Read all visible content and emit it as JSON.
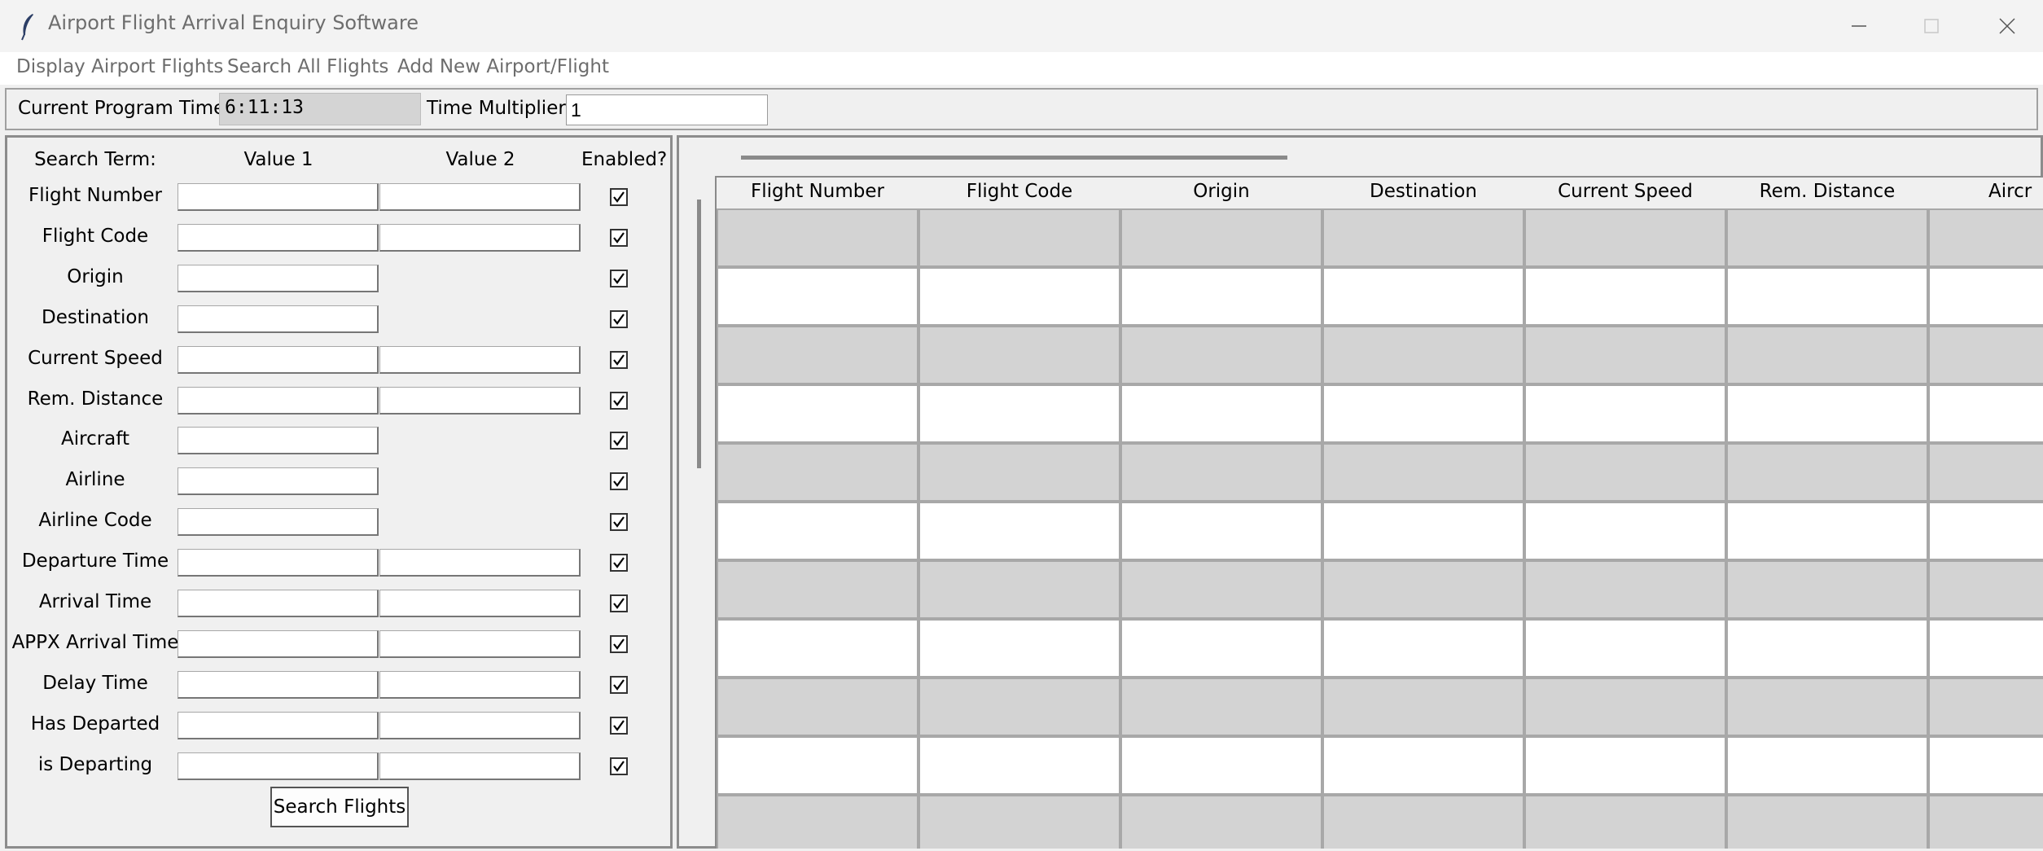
{
  "window": {
    "title": "Airport Flight Arrival Enquiry Software",
    "icon": "feather-icon",
    "controls": [
      "minimize-icon",
      "maximize-icon",
      "close-icon"
    ]
  },
  "menu": {
    "items": [
      "Display Airport Flights",
      "Search All Flights",
      "Add New Airport/Flight"
    ]
  },
  "timebar": {
    "current_time_label": "Current Program Time:",
    "current_time_value": "6:11:13",
    "multiplier_label": "Time Multiplier:",
    "multiplier_value": "1"
  },
  "search": {
    "headers": {
      "term": "Search Term:",
      "value1": "Value 1",
      "value2": "Value 2",
      "enabled": "Enabled?"
    },
    "rows": [
      {
        "label": "Flight Number",
        "value1": "",
        "value2": "",
        "has_value2": true,
        "enabled": true
      },
      {
        "label": "Flight Code",
        "value1": "",
        "value2": "",
        "has_value2": true,
        "enabled": true
      },
      {
        "label": "Origin",
        "value1": "",
        "has_value2": false,
        "enabled": true
      },
      {
        "label": "Destination",
        "value1": "",
        "has_value2": false,
        "enabled": true
      },
      {
        "label": "Current Speed",
        "value1": "",
        "value2": "",
        "has_value2": true,
        "enabled": true
      },
      {
        "label": "Rem. Distance",
        "value1": "",
        "value2": "",
        "has_value2": true,
        "enabled": true
      },
      {
        "label": "Aircraft",
        "value1": "",
        "has_value2": false,
        "enabled": true
      },
      {
        "label": "Airline",
        "value1": "",
        "has_value2": false,
        "enabled": true
      },
      {
        "label": "Airline Code",
        "value1": "",
        "has_value2": false,
        "enabled": true
      },
      {
        "label": "Departure Time",
        "value1": "",
        "value2": "",
        "has_value2": true,
        "enabled": true
      },
      {
        "label": "Arrival Time",
        "value1": "",
        "value2": "",
        "has_value2": true,
        "enabled": true
      },
      {
        "label": "APPX Arrival Time",
        "value1": "",
        "value2": "",
        "has_value2": true,
        "enabled": true
      },
      {
        "label": "Delay Time",
        "value1": "",
        "value2": "",
        "has_value2": true,
        "enabled": true
      },
      {
        "label": "Has Departed",
        "value1": "",
        "value2": "",
        "has_value2": true,
        "enabled": true
      },
      {
        "label": "is Departing",
        "value1": "",
        "value2": "",
        "has_value2": true,
        "enabled": true
      }
    ],
    "button_label": "Search Flights"
  },
  "results": {
    "columns": [
      "Flight Number",
      "Flight Code",
      "Origin",
      "Destination",
      "Current Speed",
      "Rem. Distance",
      "Aircr"
    ],
    "visible_rows": 11,
    "row_colors": [
      "#d3d3d3",
      "#ffffff"
    ]
  }
}
